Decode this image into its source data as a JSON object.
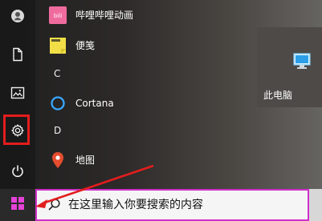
{
  "apps": [
    {
      "label": "哔哩哔哩动画",
      "icon": "bilibili-icon"
    },
    {
      "label": "便笺",
      "icon": "sticky-note-icon"
    },
    {
      "label": "Cortana",
      "icon": "cortana-icon"
    },
    {
      "label": "地图",
      "icon": "map-pin-icon"
    }
  ],
  "sections": {
    "c": "C",
    "d": "D"
  },
  "left_rail": {
    "user": "user-icon",
    "documents": "document-icon",
    "pictures": "image-icon",
    "settings": "gear-icon",
    "power": "power-icon"
  },
  "tile": {
    "label": "此电脑",
    "icon": "computer-icon"
  },
  "taskbar": {
    "start_icon": "windows-logo-icon",
    "search_icon": "search-icon",
    "search_placeholder": "在这里输入你要搜索的内容"
  },
  "colors": {
    "highlight": "#e31d1d",
    "search_border": "#cf2fcb",
    "windows_logo": "#e642d8"
  }
}
